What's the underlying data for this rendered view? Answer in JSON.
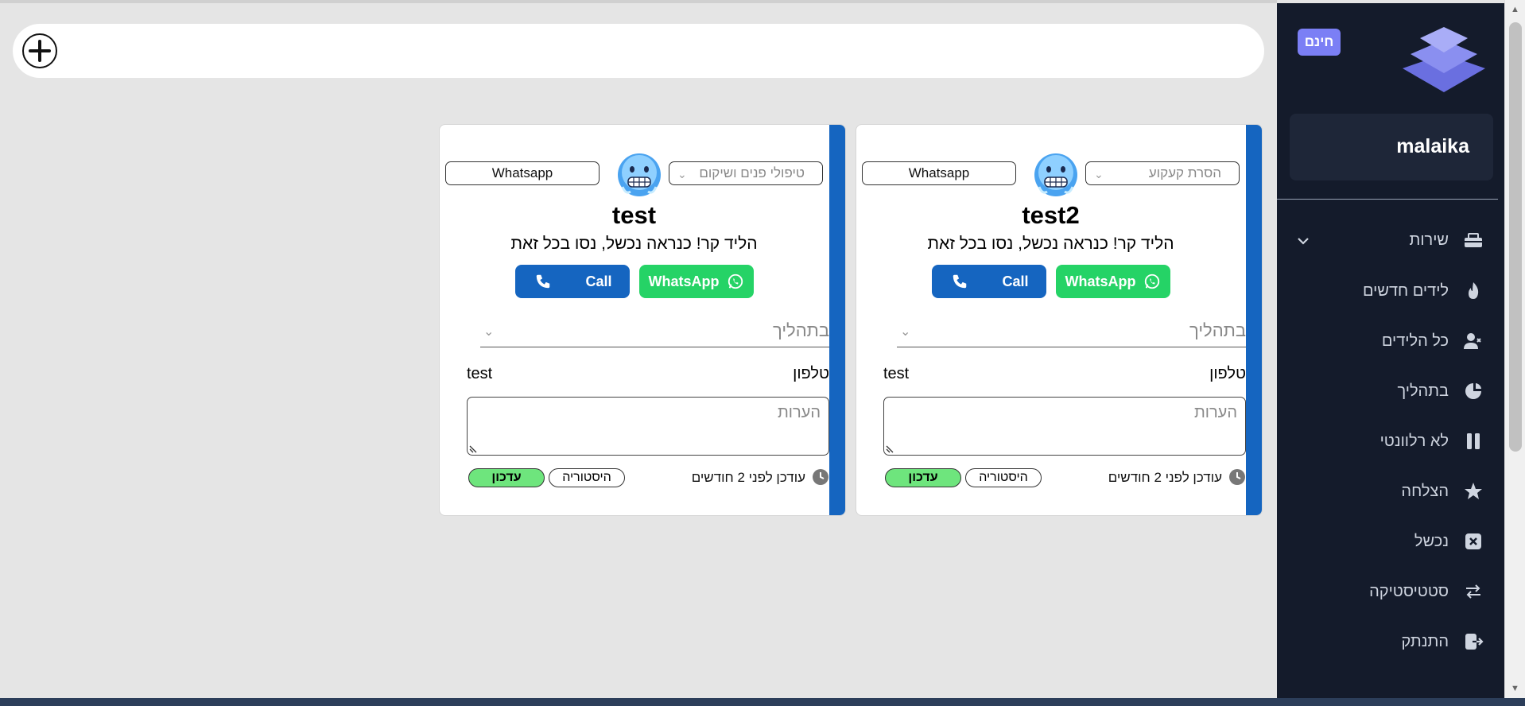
{
  "topbar": {
    "add_icon": "plus-circle-icon"
  },
  "cards": [
    {
      "source_value": "הסרת קעקוע",
      "channel_value": "Whatsapp",
      "emoji_icon": "cold-face-emoji-icon",
      "name": "test2",
      "status_text": "הליד קר! כנראה נכשל, נסו בכל זאת",
      "whatsapp_label": "WhatsApp",
      "call_label": "Call",
      "stage_value": "בתהליך",
      "phone_label": "טלפון",
      "phone_value": "test",
      "notes_placeholder": "הערות",
      "updated_text": "עודכן לפני 2 חודשים",
      "history_label": "היסטוריה",
      "update_label": "עדכון"
    },
    {
      "source_value": "טיפולי פנים ושיקום",
      "channel_value": "Whatsapp",
      "emoji_icon": "cold-face-emoji-icon",
      "name": "test",
      "status_text": "הליד קר! כנראה נכשל, נסו בכל זאת",
      "whatsapp_label": "WhatsApp",
      "call_label": "Call",
      "stage_value": "בתהליך",
      "phone_label": "טלפון",
      "phone_value": "test",
      "notes_placeholder": "הערות",
      "updated_text": "עודכן לפני 2 חודשים",
      "history_label": "היסטוריה",
      "update_label": "עדכון"
    }
  ],
  "sidebar": {
    "badge": "חינם",
    "username": "malaika",
    "items": [
      {
        "label": "שירות",
        "icon": "toolbox-icon"
      },
      {
        "label": "לידים חדשים",
        "icon": "fire-icon"
      },
      {
        "label": "כל הלידים",
        "icon": "users-icon"
      },
      {
        "label": "בתהליך",
        "icon": "process-icon"
      },
      {
        "label": "לא רלוונטי",
        "icon": "pause-icon"
      },
      {
        "label": "הצלחה",
        "icon": "star-icon"
      },
      {
        "label": "נכשל",
        "icon": "x-box-icon"
      },
      {
        "label": "סטטיסטיקה",
        "icon": "arrows-icon"
      },
      {
        "label": "התנתק",
        "icon": "logout-icon"
      }
    ]
  },
  "colors": {
    "accent_blue": "#1565c0",
    "whatsapp_green": "#25d366",
    "update_green": "#6ee57d",
    "sidebar_bg": "#141b2b",
    "badge_purple": "#7b7ff5"
  }
}
